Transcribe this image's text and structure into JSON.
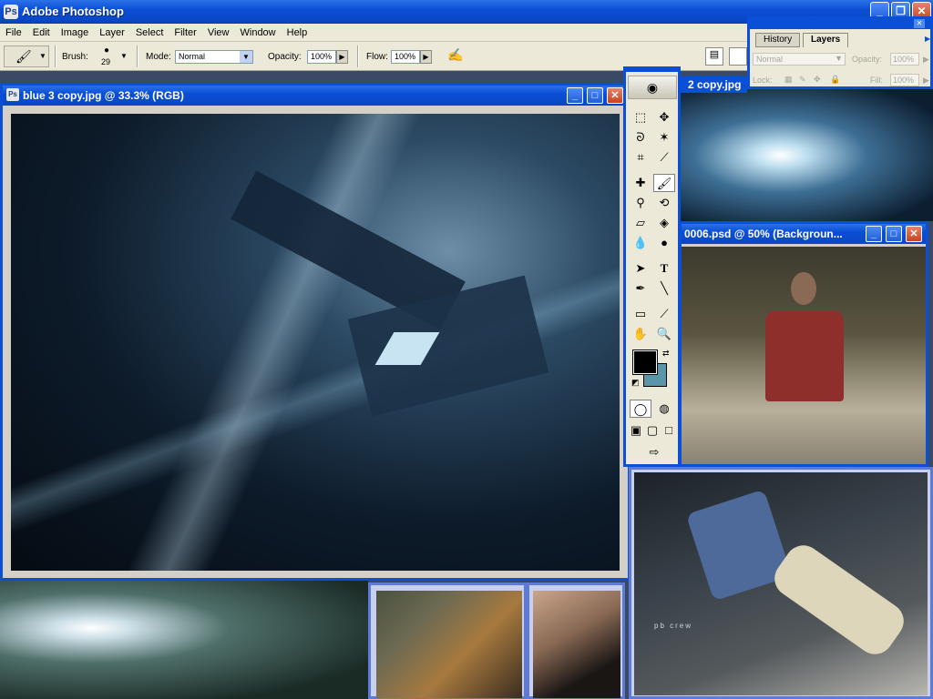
{
  "app": {
    "title": "Adobe Photoshop"
  },
  "menu": [
    "File",
    "Edit",
    "Image",
    "Layer",
    "Select",
    "Filter",
    "View",
    "Window",
    "Help"
  ],
  "options": {
    "brush_label": "Brush:",
    "brush_size": "29",
    "mode_label": "Mode:",
    "mode_value": "Normal",
    "opacity_label": "Opacity:",
    "opacity_value": "100%",
    "flow_label": "Flow:",
    "flow_value": "100%"
  },
  "layers_palette": {
    "tabs": [
      "History",
      "Layers"
    ],
    "blend_mode": "Normal",
    "opacity_label": "Opacity:",
    "opacity_value": "100%",
    "lock_label": "Lock:",
    "fill_label": "Fill:",
    "fill_value": "100%"
  },
  "documents": {
    "main_title": "blue 3 copy.jpg @ 33.3% (RGB)",
    "second_title": "2 copy.jpg",
    "third_title": "0006.psd @ 50% (Backgroun..."
  },
  "canvas_text": {
    "photo_caption": "pb crew"
  },
  "colors": {
    "foreground": "#000000",
    "background": "#5b96a8",
    "titlebar": "#0b4fd6"
  }
}
